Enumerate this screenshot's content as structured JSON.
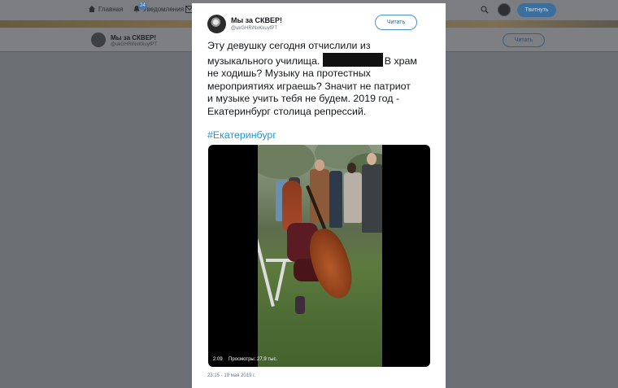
{
  "topnav": {
    "home_label": "Главная",
    "notifications_label": "Уведомления",
    "notifications_count": "24",
    "tweet_button_label": "Твитнуть"
  },
  "profile_bar": {
    "name": "Мы за СКВЕР!",
    "handle": "@ukGHRiNxKkuyfPT",
    "follow_label": "Читать"
  },
  "tweet": {
    "author_name": "Мы за СКВЕР!",
    "author_handle": "@ukGHRiNxKkuyfPT",
    "follow_label": "Читать",
    "text_lines": [
      "Эту девушку сегодня отчислили из",
      "музыкального училища.",
      "В храм",
      "не ходишь? Музыку на протестных",
      "мероприятиях играешь? Значит не патриот",
      "и музыке учить тебя не будем. 2019 год -",
      "Екатеринбург столица репрессий."
    ],
    "hashtag": "#Екатеринбург",
    "video": {
      "duration": "2:09",
      "views": "Просмотры: 27,9 тыс."
    },
    "timestamp": "23:15 - 19 мая 2019 г."
  },
  "colors": {
    "link": "#1b95e0",
    "overlay": "#6b6f73",
    "modal_bg": "#ffffff"
  }
}
